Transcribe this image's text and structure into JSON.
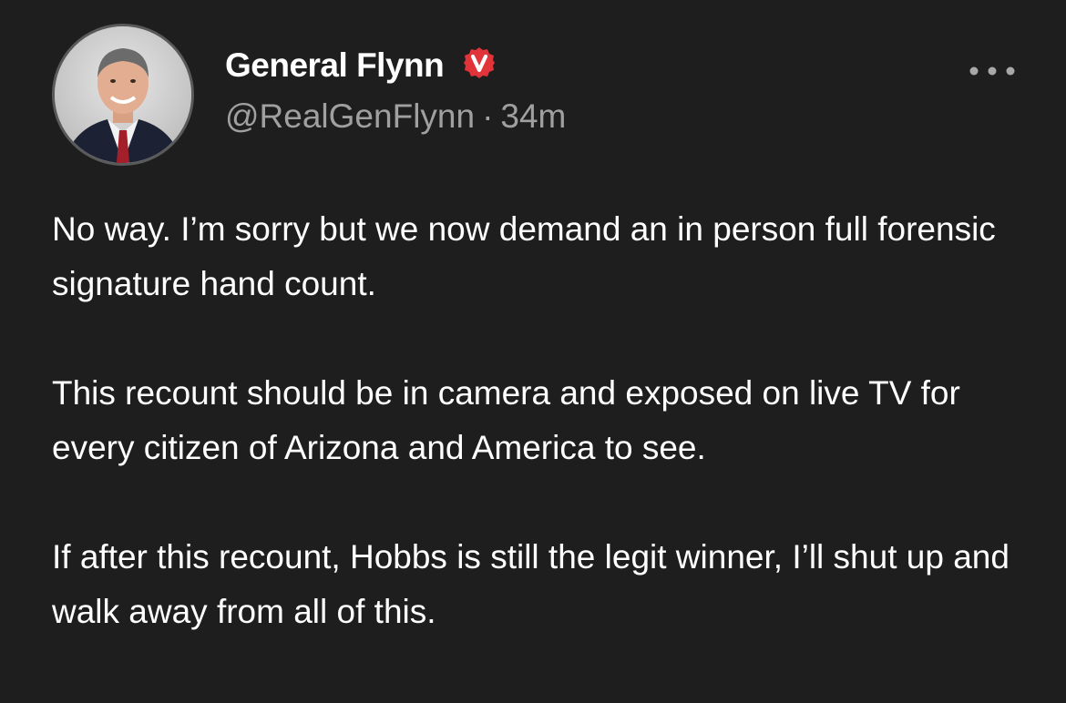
{
  "author": {
    "display_name": "General Flynn",
    "handle": "@RealGenFlynn",
    "verified_badge": "verified-v-icon",
    "badge_color": "#e0343a",
    "avatar": "profile-photo"
  },
  "meta": {
    "separator": "·",
    "time": "34m"
  },
  "actions": {
    "more_icon": "ellipsis-icon"
  },
  "post": {
    "paragraphs": [
      "No way. I’m sorry but we now demand an in person full forensic signature hand count.",
      "This recount should be in camera and exposed on live TV for every citizen of Arizona and America to see.",
      "If after this recount, Hobbs is still the legit winner, I’ll shut up and walk away from all of this."
    ]
  },
  "colors": {
    "background": "#1e1e1e",
    "text_primary": "#ffffff",
    "text_secondary": "#a0a0a0"
  }
}
